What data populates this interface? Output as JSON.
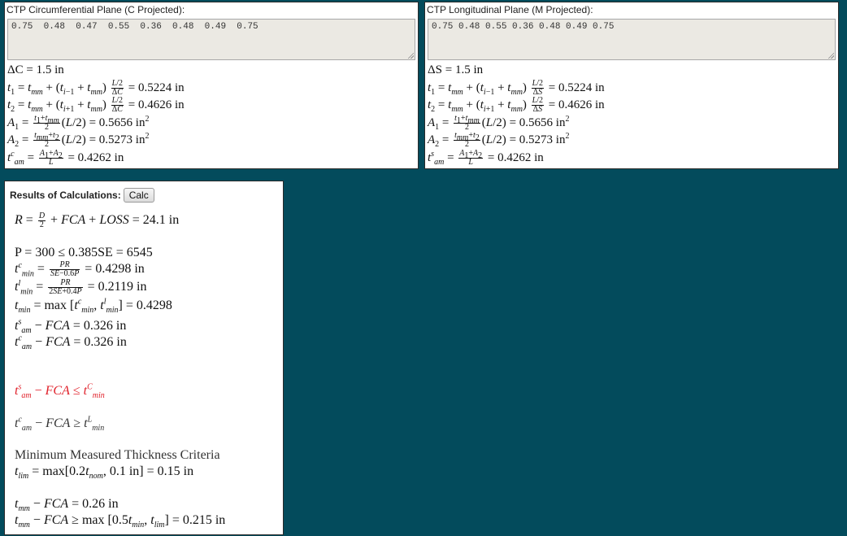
{
  "panel_c": {
    "label": "CTP Circumferential Plane (C Projected):",
    "values_text": "0.75  0.48  0.47  0.55  0.36  0.48  0.49  0.75",
    "delta": "ΔC = 1.5 in",
    "t1_value": "= 0.5224 in",
    "t2_value": "= 0.4626 in",
    "A1_value": "= 0.5656 in",
    "A2_value": "= 0.5273 in",
    "tam_value": "= 0.4262 in"
  },
  "panel_m": {
    "label": "CTP Longitudinal Plane (M Projected):",
    "values_text": "0.75 0.48 0.55 0.36 0.48 0.49 0.75",
    "delta": "ΔS = 1.5 in",
    "t1_value": "= 0.5224 in",
    "t2_value": "= 0.4626 in",
    "A1_value": "= 0.5656 in",
    "A2_value": "= 0.5273 in",
    "tam_value": "= 0.4262 in"
  },
  "results": {
    "heading": "Results of Calculations:",
    "calc_label": "Calc",
    "R_value": "= 24.1 in",
    "P_line": "P = 300 ≤ 0.385SE = 6545",
    "tminc_value": "= 0.4298  in",
    "tminl_value": "= 0.2119  in",
    "tmin_value": "= 0.4298",
    "tams_fca": "= 0.326 in",
    "tamc_fca": "= 0.326 in",
    "criteria_title": "Minimum Measured Thickness Criteria",
    "tlim_value": "= 0.15 in",
    "tmm_fca": "= 0.26 in",
    "tmm_crit_value": "= 0.215 in",
    "fail_color": "#e0202a"
  }
}
